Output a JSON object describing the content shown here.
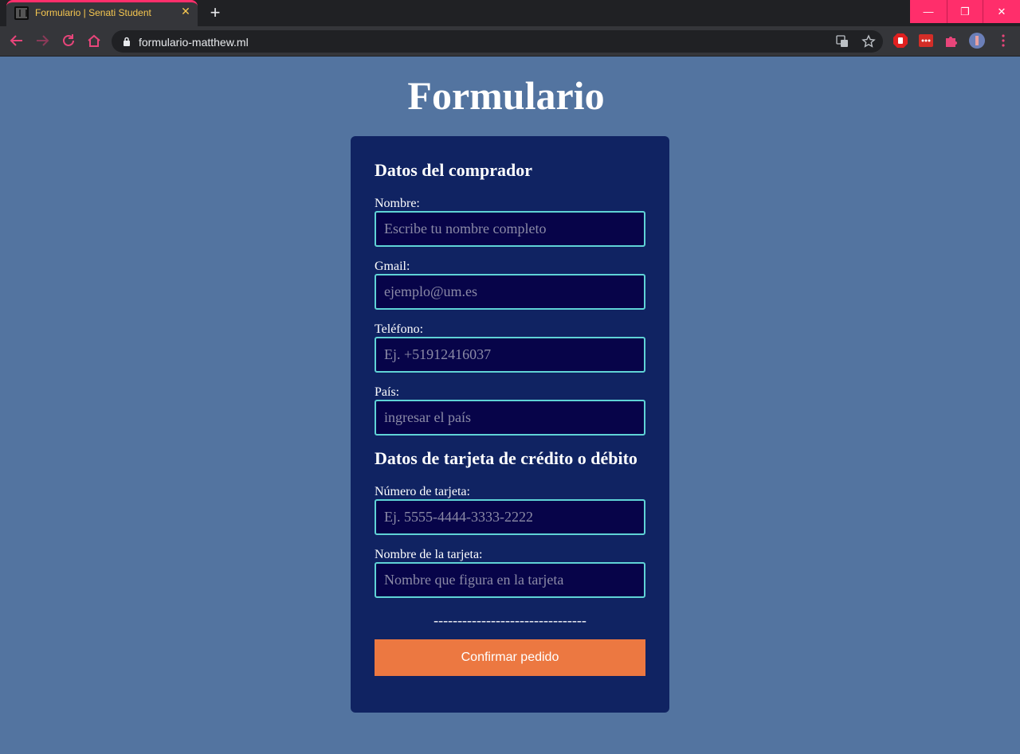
{
  "browser": {
    "tab_title": "Formulario | Senati Student",
    "tab_close": "✕",
    "new_tab": "+",
    "url": "formulario-matthew.ml",
    "window_controls": {
      "minimize": "—",
      "restore": "❐",
      "close": "✕"
    },
    "accent_color": "#ff2e6b",
    "tab_text_color": "#f6c750"
  },
  "page": {
    "title": "Formulario",
    "background_color": "#5374a0"
  },
  "form": {
    "buyer_section_title": "Datos del comprador",
    "card_section_title": "Datos de tarjeta de crédito o débito",
    "fields": {
      "nombre": {
        "label": "Nombre:",
        "placeholder": "Escribe tu nombre completo",
        "value": ""
      },
      "gmail": {
        "label": "Gmail:",
        "placeholder": "ejemplo@um.es",
        "value": ""
      },
      "telefono": {
        "label": "Teléfono:",
        "placeholder": "Ej. +51912416037",
        "value": ""
      },
      "pais": {
        "label": "País:",
        "placeholder": "ingresar el país",
        "value": ""
      },
      "numero_tarjeta": {
        "label": "Número de tarjeta:",
        "placeholder": "Ej. 5555-4444-3333-2222",
        "value": ""
      },
      "nombre_tarjeta": {
        "label": "Nombre de la tarjeta:",
        "placeholder": "Nombre que figura en la tarjeta",
        "value": ""
      }
    },
    "divider": "--------------------------------",
    "submit_label": "Confirmar pedido",
    "card_color": "#102362",
    "input_border_color": "#5fd3d6",
    "submit_color": "#ec7841"
  }
}
